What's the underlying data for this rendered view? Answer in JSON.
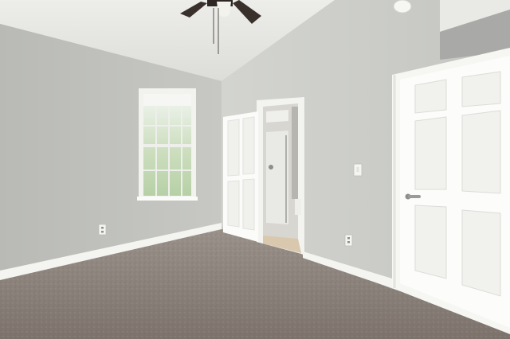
{
  "scene": {
    "kind": "photo",
    "subject": "empty-bedroom",
    "objects": [
      "ceiling-fan",
      "smoke-detector",
      "window",
      "open-door",
      "bathroom-glimpse",
      "closet-door",
      "door-handle",
      "light-switch",
      "outlet-left",
      "outlet-right",
      "baseboard",
      "carpet"
    ],
    "colors": {
      "wall_left": "#c3c4c0",
      "wall_right": "#cfd0cc",
      "ceiling": "#e6e6e3",
      "trim": "#f4f4f1",
      "carpet": "#8a8079",
      "fan": "#3a302b"
    }
  }
}
